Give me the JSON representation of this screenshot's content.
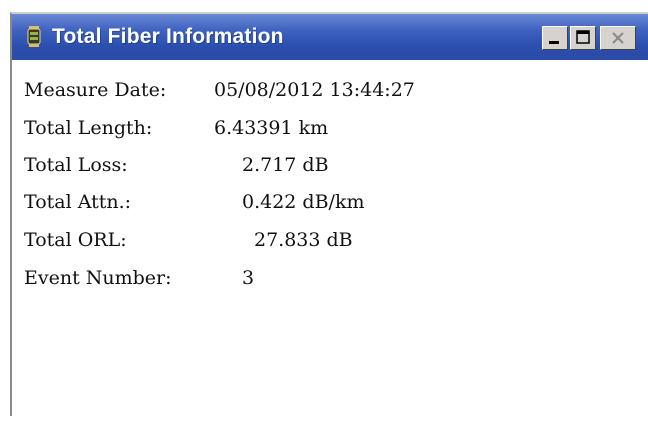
{
  "window": {
    "title": "Total Fiber Information",
    "title_icon": "fiber-reel-icon",
    "controls": {
      "minimize_icon": "minimize-icon",
      "maximize_icon": "maximize-icon",
      "close_icon": "close-icon"
    },
    "colors": {
      "titlebar": "#2b4fae",
      "background": "#ffffff"
    }
  },
  "info": {
    "measure_date": {
      "label": "Measure Date:",
      "value": "05/08/2012 13:44:27"
    },
    "total_length": {
      "label": "Total Length:",
      "value": "6.43391 km"
    },
    "total_loss": {
      "label": "Total Loss:",
      "value": "2.717 dB"
    },
    "total_attn": {
      "label": "Total Attn.:",
      "value": "0.422 dB/km"
    },
    "total_orl": {
      "label": "Total ORL:",
      "value": "27.833 dB"
    },
    "event_number": {
      "label": "Event Number:",
      "value": "3"
    }
  }
}
